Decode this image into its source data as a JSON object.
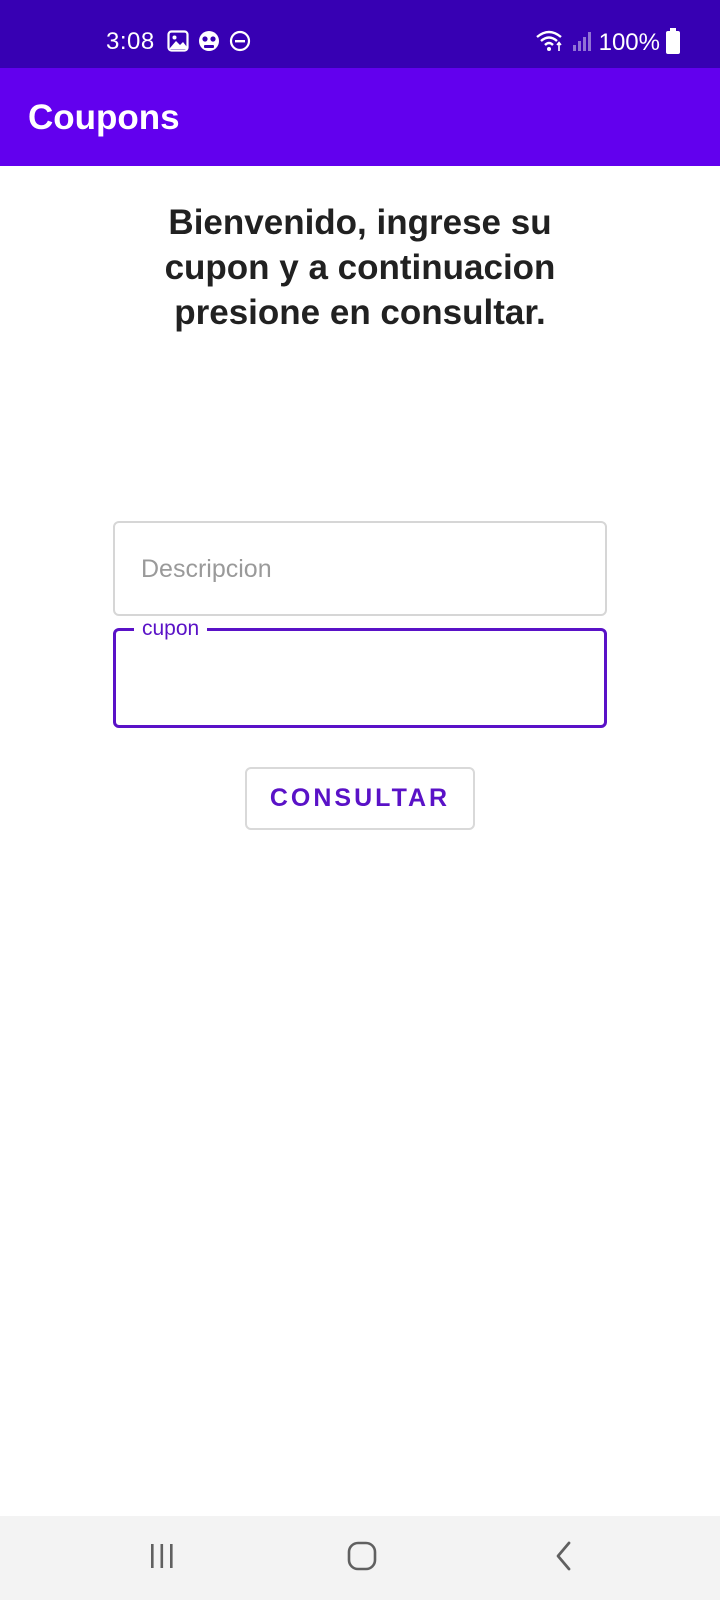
{
  "status_bar": {
    "time": "3:08",
    "battery": "100%",
    "icons": [
      "gallery-icon",
      "game-icon",
      "do-not-disturb-icon",
      "wifi-icon",
      "signal-icon",
      "battery-icon"
    ],
    "background": "#3700b3"
  },
  "app_bar": {
    "title": "Coupons",
    "background": "#6200ee"
  },
  "main": {
    "welcome_line1": "Bienvenido, ingrese su",
    "welcome_line2": "cupon y a continuacion",
    "welcome_line3": "presione en consultar.",
    "description_field": {
      "placeholder": "Descripcion",
      "value": ""
    },
    "cupon_field": {
      "label": "cupon",
      "value": "",
      "accent": "#5a12c7"
    },
    "consult_button": "CONSULTAR"
  },
  "nav_bar": {
    "icons": [
      "recent-apps-icon",
      "home-icon",
      "back-icon"
    ]
  }
}
